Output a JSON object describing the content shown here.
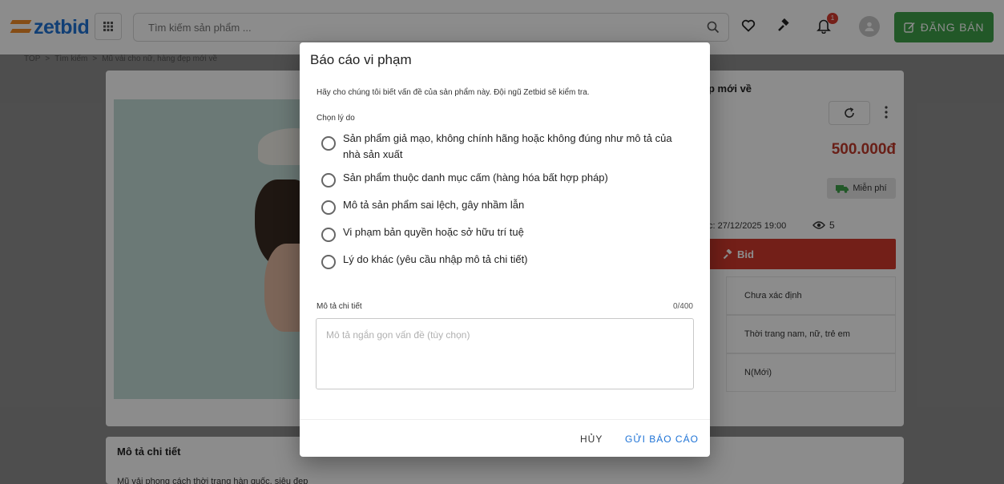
{
  "header": {
    "logo_text": "zetbid",
    "search_placeholder": "Tìm kiếm sản phẩm ...",
    "notification_count": "1",
    "sell_button_label": "ĐĂNG BÁN",
    "brand_color": "#1f73d6",
    "sell_color": "#3fa14a"
  },
  "breadcrumb": {
    "items": [
      "TOP",
      "Tìm kiếm",
      "Mũ vải cho nữ, hàng đẹp mới về"
    ],
    "separator": ">"
  },
  "product": {
    "title_partial": "p mới về",
    "price": "500.000đ",
    "shipping": "Miễn phí",
    "end_time": "c: 27/12/2025 19:00",
    "views": "5",
    "bid_label": "Bid",
    "info_rows": [
      "Chưa xác định",
      "Thời trang nam, nữ, trẻ em",
      "N(Mới)"
    ],
    "price_color": "#c0392b",
    "bid_color": "#d13a2c"
  },
  "description": {
    "title": "Mô tả chi tiết",
    "text": "Mũ vải phong cách thời trang hàn quốc, siêu đẹp"
  },
  "modal": {
    "title": "Báo cáo vi phạm",
    "description": "Hãy cho chúng tôi biết vấn đề của sản phẩm này. Đội ngũ Zetbid sẽ kiểm tra.",
    "reason_label": "Chọn lý do",
    "reasons": [
      "Sản phẩm giả mạo, không chính hãng hoặc không đúng như mô tả của nhà sản xuất",
      "Sản phẩm thuộc danh mục cấm (hàng hóa bất hợp pháp)",
      "Mô tả sản phẩm sai lệch, gây nhầm lẫn",
      "Vi phạm bản quyền hoặc sở hữu trí tuệ",
      "Lý do khác (yêu cầu nhập mô tả chi tiết)"
    ],
    "detail_label": "Mô tả chi tiết",
    "char_count": "0/400",
    "detail_placeholder": "Mô tả ngắn gọn vấn đề (tùy chọn)",
    "cancel_label": "HỦY",
    "submit_label": "GỬI BÁO CÁO",
    "submit_color": "#1e73d6"
  }
}
